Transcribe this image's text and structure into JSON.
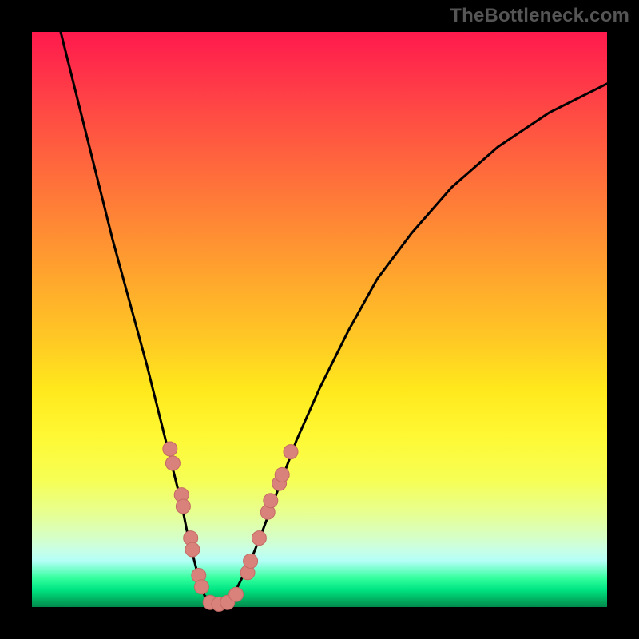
{
  "attribution": "TheBottleneck.com",
  "colors": {
    "curve": "#000000",
    "marker_fill": "#d9817b",
    "marker_stroke": "#c46a64"
  },
  "chart_data": {
    "type": "line",
    "title": "",
    "xlabel": "",
    "ylabel": "",
    "xlim": [
      0,
      100
    ],
    "ylim": [
      0,
      100
    ],
    "series": [
      {
        "name": "bottleneck-curve",
        "x": [
          5,
          8,
          11,
          14,
          17,
          20,
          22,
          24,
          26,
          27,
          28,
          29,
          30,
          31,
          32,
          33,
          34,
          35,
          36,
          38,
          40,
          43,
          46,
          50,
          55,
          60,
          66,
          73,
          81,
          90,
          100
        ],
        "y": [
          100,
          88,
          76,
          64,
          53,
          42,
          34,
          26,
          18,
          13,
          9,
          5,
          2,
          1,
          0,
          0,
          1,
          2,
          4,
          8,
          13,
          21,
          29,
          38,
          48,
          57,
          65,
          73,
          80,
          86,
          91
        ]
      }
    ],
    "markers": [
      {
        "x": 24.0,
        "y": 27.5
      },
      {
        "x": 24.5,
        "y": 25.0
      },
      {
        "x": 26.0,
        "y": 19.5
      },
      {
        "x": 26.3,
        "y": 17.5
      },
      {
        "x": 27.6,
        "y": 12.0
      },
      {
        "x": 27.9,
        "y": 10.0
      },
      {
        "x": 29.0,
        "y": 5.5
      },
      {
        "x": 29.5,
        "y": 3.5
      },
      {
        "x": 31.0,
        "y": 0.8
      },
      {
        "x": 32.5,
        "y": 0.5
      },
      {
        "x": 34.0,
        "y": 0.8
      },
      {
        "x": 35.5,
        "y": 2.2
      },
      {
        "x": 37.5,
        "y": 6.0
      },
      {
        "x": 38.0,
        "y": 8.0
      },
      {
        "x": 39.5,
        "y": 12.0
      },
      {
        "x": 41.0,
        "y": 16.5
      },
      {
        "x": 41.5,
        "y": 18.5
      },
      {
        "x": 43.0,
        "y": 21.5
      },
      {
        "x": 43.5,
        "y": 23.0
      },
      {
        "x": 45.0,
        "y": 27.0
      }
    ]
  }
}
